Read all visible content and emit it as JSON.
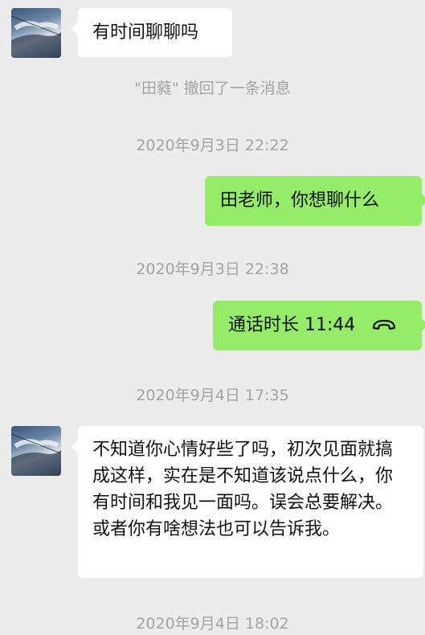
{
  "messages": {
    "m1": "有时间聊聊吗",
    "recall": "\"田蕤\" 撤回了一条消息",
    "t1": "2020年9月3日 22:22",
    "m2": "田老师，你想聊什么",
    "t2": "2020年9月3日 22:38",
    "call": "通话时长 11:44",
    "t3": "2020年9月4日 17:35",
    "m3": "不知道你心情好些了吗，初次见面就搞成这样，实在是不知道该说点什么，你有时间和我见一面吗。误会总要解决。或者你有啥想法也可以告诉我。",
    "t4": "2020年9月4日 18:02"
  },
  "icons": {
    "call": "hangup-phone-icon",
    "avatar": "sky-photo-avatar"
  },
  "colors": {
    "background": "#ececec",
    "outgoing": "#95ec69",
    "incoming": "#ffffff"
  }
}
